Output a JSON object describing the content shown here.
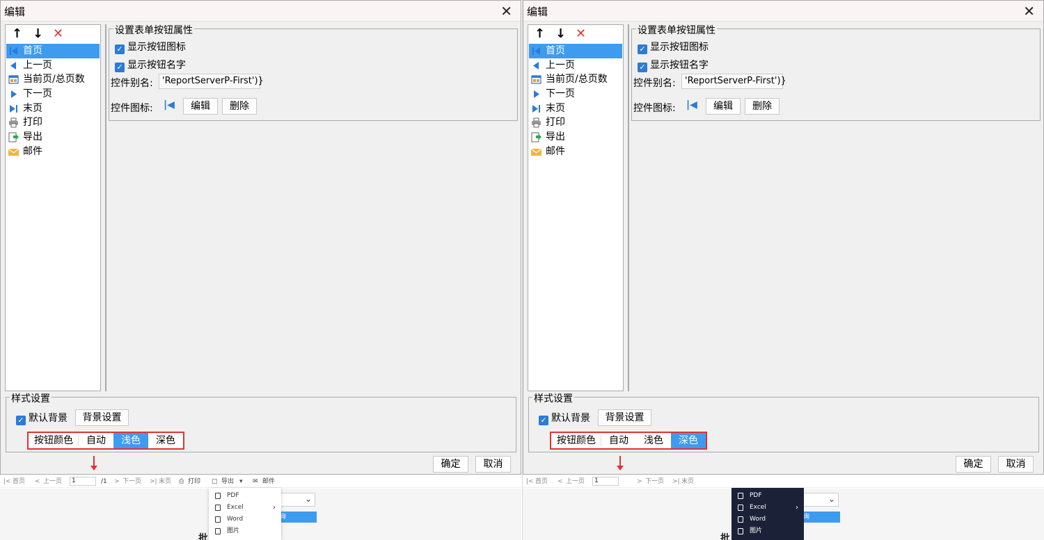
{
  "panels": [
    {
      "dialog_title": "编辑",
      "list_items": [
        "首页",
        "上一页",
        "当前页/总页数",
        "下一页",
        "末页",
        "打印",
        "导出",
        "邮件"
      ],
      "selected_index": 0,
      "props_legend": "设置表单按钮属性",
      "show_icon_label": "显示按钮图标",
      "show_name_label": "显示按钮名字",
      "alias_label": "控件别名:",
      "alias_value": "'ReportServerP-First')}",
      "icon_label": "控件图标:",
      "edit_label": "编辑",
      "delete_label": "删除",
      "style_legend": "样式设置",
      "default_bg_label": "默认背景",
      "bg_settings_label": "背景设置",
      "button_color_label": "按钮颜色",
      "color_options": [
        "自动",
        "浅色",
        "深色"
      ],
      "active_color_index": 1,
      "ok_label": "确定",
      "cancel_label": "取消",
      "preview_toolbar": {
        "first": "首页",
        "prev": "上一页",
        "page": "1",
        "total": "/1",
        "next": "下一页",
        "last": "末页",
        "print": "打印",
        "export": "导出",
        "mail": "邮件"
      },
      "preview_blue_text": "询",
      "preview_fragment": "批",
      "export_menu_theme": "light",
      "export_menu": [
        "PDF",
        "Excel",
        "Word",
        "图片"
      ]
    },
    {
      "dialog_title": "编辑",
      "list_items": [
        "首页",
        "上一页",
        "当前页/总页数",
        "下一页",
        "末页",
        "打印",
        "导出",
        "邮件"
      ],
      "selected_index": 0,
      "props_legend": "设置表单按钮属性",
      "show_icon_label": "显示按钮图标",
      "show_name_label": "显示按钮名字",
      "alias_label": "控件别名:",
      "alias_value": "'ReportServerP-First')}",
      "icon_label": "控件图标:",
      "edit_label": "编辑",
      "delete_label": "删除",
      "style_legend": "样式设置",
      "default_bg_label": "默认背景",
      "bg_settings_label": "背景设置",
      "button_color_label": "按钮颜色",
      "color_options": [
        "自动",
        "浅色",
        "深色"
      ],
      "active_color_index": 2,
      "ok_label": "确定",
      "cancel_label": "取消",
      "preview_toolbar": {
        "first": "首页",
        "prev": "上一页",
        "page": "1",
        "total": "",
        "next": "下一页",
        "last": "末页",
        "print": "",
        "export": "",
        "mail": ""
      },
      "preview_blue_text": "询",
      "preview_fragment": "批",
      "export_menu_theme": "dark",
      "export_menu": [
        "PDF",
        "Excel",
        "Word",
        "图片"
      ]
    }
  ],
  "colors": {
    "accent": "#3d9bf0",
    "highlight_border": "#e53030",
    "dark_menu": "#1b2137"
  }
}
